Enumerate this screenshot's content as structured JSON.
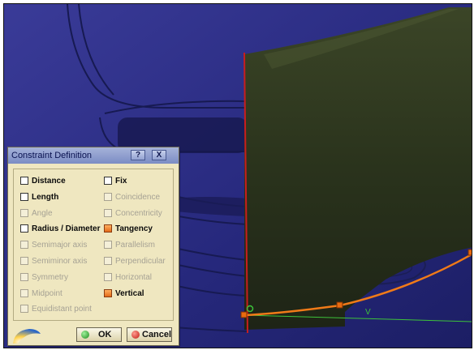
{
  "dialog": {
    "title": "Constraint Definition",
    "help_label": "?",
    "close_label": "X",
    "options": [
      {
        "label": "Distance",
        "checked": false,
        "enabled": true
      },
      {
        "label": "Fix",
        "checked": false,
        "enabled": true
      },
      {
        "label": "Length",
        "checked": false,
        "enabled": true
      },
      {
        "label": "Coincidence",
        "checked": false,
        "enabled": false
      },
      {
        "label": "Angle",
        "checked": false,
        "enabled": false
      },
      {
        "label": "Concentricity",
        "checked": false,
        "enabled": false
      },
      {
        "label": "Radius / Diameter",
        "checked": false,
        "enabled": true
      },
      {
        "label": "Tangency",
        "checked": true,
        "enabled": true
      },
      {
        "label": "Semimajor axis",
        "checked": false,
        "enabled": false
      },
      {
        "label": "Parallelism",
        "checked": false,
        "enabled": false
      },
      {
        "label": "Semiminor axis",
        "checked": false,
        "enabled": false
      },
      {
        "label": "Perpendicular",
        "checked": false,
        "enabled": false
      },
      {
        "label": "Symmetry",
        "checked": false,
        "enabled": false
      },
      {
        "label": "Horizontal",
        "checked": false,
        "enabled": false
      },
      {
        "label": "Midpoint",
        "checked": false,
        "enabled": false
      },
      {
        "label": "Vertical",
        "checked": true,
        "enabled": true
      },
      {
        "label": "Equidistant point",
        "checked": false,
        "enabled": false
      }
    ],
    "ok_label": "OK",
    "cancel_label": "Cancel"
  },
  "viewport": {
    "curve_labels": [
      "V"
    ],
    "colors": {
      "background": "#2a2b84",
      "surface": "#2f3a22",
      "curve": "#f07a18",
      "edge": "#c81e1e",
      "axis": "#3dc33a"
    }
  }
}
